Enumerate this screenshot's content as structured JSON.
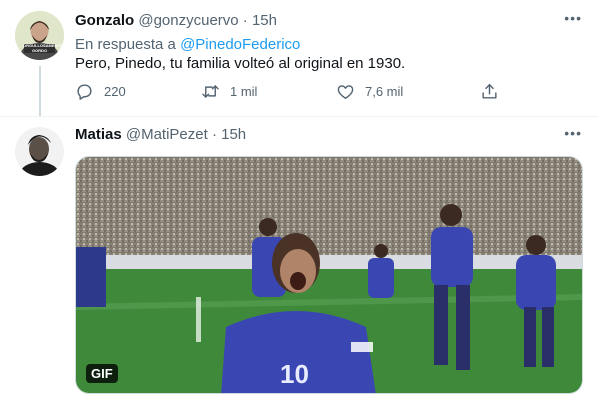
{
  "tweet1": {
    "name": "Gonzalo",
    "handle": "@gonzycuervo",
    "separator": "·",
    "time": "15h",
    "more_label": "•••",
    "replying_prefix": "En respuesta a",
    "replying_to": "@PinedoFederico",
    "text": "Pero, Pinedo, tu familia volteó al original en 1930.",
    "actions": {
      "reply_count": "220",
      "retweet_count": "1 mil",
      "like_count": "7,6 mil"
    },
    "avatar_caption": "ORGULLOSAMENTE GORDO"
  },
  "tweet2": {
    "name": "Matias",
    "handle": "@MatiPezet",
    "separator": "·",
    "time": "15h",
    "more_label": "•••",
    "media_badge": "GIF",
    "jersey_number": "10"
  },
  "colors": {
    "accent": "#1d9bf0",
    "muted": "#536471",
    "text": "#0f1419",
    "pitch": "#3f8a3a"
  },
  "icons": [
    "reply-icon",
    "retweet-icon",
    "like-icon",
    "share-icon",
    "more-icon"
  ]
}
